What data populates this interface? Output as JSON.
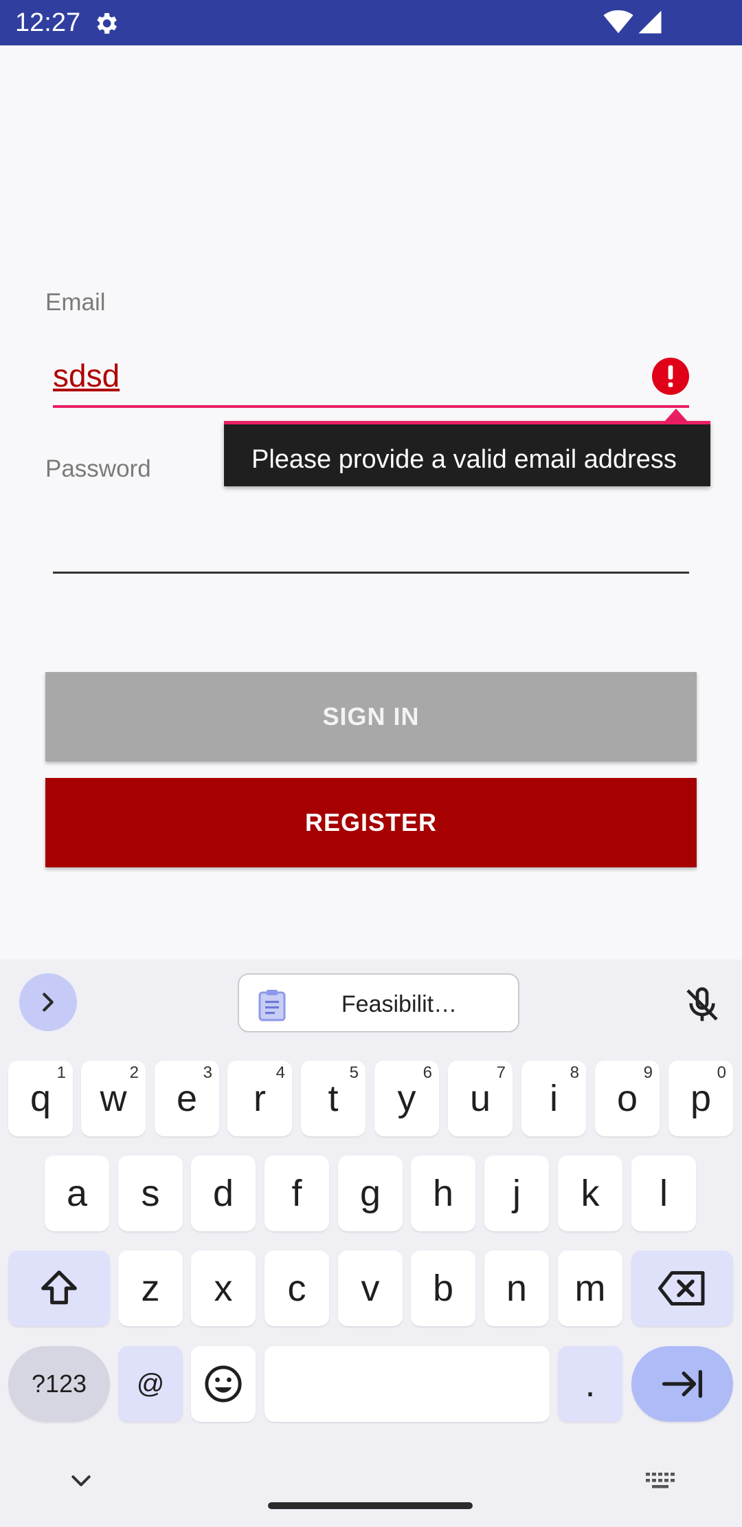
{
  "status_bar": {
    "time": "12:27"
  },
  "form": {
    "email_label": "Email",
    "email_value": "sdsd",
    "email_error": "Please provide a valid email address",
    "password_label": "Password",
    "password_value": ""
  },
  "buttons": {
    "sign_in": "SIGN IN",
    "register": "REGISTER"
  },
  "colors": {
    "status_bar": "#303f9f",
    "error": "#e91e63",
    "register": "#a60000",
    "sign_in_disabled": "#a8a8a8"
  },
  "keyboard": {
    "clipboard_suggestion": "Feasibilit…",
    "row1": [
      {
        "key": "q",
        "hint": "1"
      },
      {
        "key": "w",
        "hint": "2"
      },
      {
        "key": "e",
        "hint": "3"
      },
      {
        "key": "r",
        "hint": "4"
      },
      {
        "key": "t",
        "hint": "5"
      },
      {
        "key": "y",
        "hint": "6"
      },
      {
        "key": "u",
        "hint": "7"
      },
      {
        "key": "i",
        "hint": "8"
      },
      {
        "key": "o",
        "hint": "9"
      },
      {
        "key": "p",
        "hint": "0"
      }
    ],
    "row2": [
      "a",
      "s",
      "d",
      "f",
      "g",
      "h",
      "j",
      "k",
      "l"
    ],
    "row3": [
      "z",
      "x",
      "c",
      "v",
      "b",
      "n",
      "m"
    ],
    "symbols_key": "?123",
    "at_key": "@",
    "period_key": "."
  },
  "icons": {
    "status": [
      "gear-icon",
      "wifi-icon",
      "signal-icon"
    ],
    "email_error": "error-icon",
    "keyboard": [
      "chevron-right-icon",
      "clipboard-icon",
      "mic-off-icon",
      "shift-icon",
      "backspace-icon",
      "emoji-icon",
      "enter-icon"
    ],
    "nav": [
      "chevron-down-icon",
      "keyboard-icon"
    ]
  }
}
